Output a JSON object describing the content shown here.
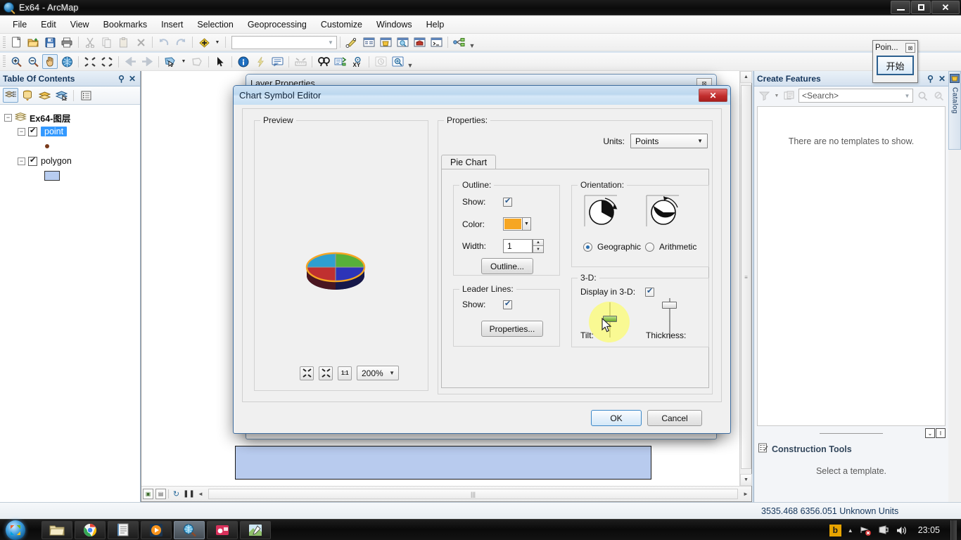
{
  "window": {
    "title": "Ex64 - ArcMap",
    "minimize_label": "—",
    "maximize_label": "❐",
    "close_label": "✕"
  },
  "menu": {
    "items": [
      {
        "label": "File"
      },
      {
        "label": "Edit"
      },
      {
        "label": "View"
      },
      {
        "label": "Bookmarks"
      },
      {
        "label": "Insert"
      },
      {
        "label": "Selection"
      },
      {
        "label": "Geoprocessing"
      },
      {
        "label": "Customize"
      },
      {
        "label": "Windows"
      },
      {
        "label": "Help"
      }
    ]
  },
  "toolbar_standard": {
    "icons": [
      "new-document-icon",
      "open-folder-icon",
      "save-icon",
      "print-icon",
      "cut-icon",
      "copy-icon",
      "paste-icon",
      "delete-icon",
      "undo-icon",
      "redo-icon",
      "add-data-icon"
    ],
    "scale_value": "",
    "scale_placeholder": "",
    "right_icons": [
      "editor-toolbar-icon",
      "table-of-contents-icon",
      "catalog-window-icon",
      "search-window-icon",
      "arctoolbox-icon",
      "python-window-icon",
      "modelbuilder-icon"
    ]
  },
  "toolbar_tools": {
    "icons": [
      "zoom-in-icon",
      "zoom-out-icon",
      "pan-icon",
      "full-extent-icon",
      "fixed-zoom-in-icon",
      "fixed-zoom-out-icon",
      "go-back-icon",
      "go-forward-icon",
      "select-features-icon",
      "clear-selection-icon",
      "select-elements-icon",
      "identify-icon",
      "hyperlink-icon",
      "html-popup-icon",
      "measure-icon",
      "find-icon",
      "find-route-icon",
      "go-to-xy-icon",
      "time-slider-icon",
      "create-viewer-icon"
    ]
  },
  "toc": {
    "title": "Table Of Contents",
    "pin_icon": "pin-icon",
    "close_icon": "close-icon",
    "toolbar_icons": [
      "list-by-drawing-order-icon",
      "list-by-source-icon",
      "list-by-visibility-icon",
      "list-by-selection-icon",
      "options-icon"
    ],
    "tree": {
      "root_label": "Ex64-图层",
      "layers": [
        {
          "label": "point",
          "checked": true,
          "selected": true,
          "symbol": "point-symbol"
        },
        {
          "label": "polygon",
          "checked": true,
          "selected": false,
          "symbol": "polygon-symbol"
        }
      ]
    }
  },
  "map": {
    "hbar_icons": [
      "data-view-icon",
      "layout-view-icon",
      "refresh-icon",
      "pause-icon"
    ],
    "scroll_left": "◄",
    "scroll_right": "►",
    "scroll_up": "▲",
    "scroll_down": "▼",
    "thumb_grip": "≡"
  },
  "point_floater": {
    "title": "Poin...",
    "close_label": "⊠",
    "start_button": "开始"
  },
  "layer_properties": {
    "title": "Layer Properties",
    "close_label": "⊠"
  },
  "create_features": {
    "title": "Create Features",
    "pin_icon": "pin-icon",
    "close_icon": "close-icon",
    "toolbar_icons": [
      "organize-templates-icon",
      "template-properties-icon"
    ],
    "search_value": "<Search>",
    "search_placeholder": "<Search>",
    "search_icons": [
      "search-icon",
      "clear-search-icon"
    ],
    "empty_message": "There are no templates to show.",
    "divider_buttons": [
      "⌄",
      "I"
    ],
    "construction_tools": {
      "icon": "construction-tools-icon",
      "title": "Construction Tools",
      "message": "Select a template."
    }
  },
  "catalog_tab": {
    "label": "Catalog",
    "icon": "catalog-icon"
  },
  "status_bar": {
    "coordinates": "3535.468  6356.051 Unknown Units"
  },
  "dialog": {
    "title": "Chart Symbol Editor",
    "close_label": "✕",
    "preview": {
      "group_label": "Preview",
      "zoom_buttons": [
        {
          "name": "zoom-out-preview-button",
          "glyph": "⤡⤢"
        },
        {
          "name": "zoom-in-preview-button",
          "glyph": "⤢⤡"
        },
        {
          "name": "actual-size-button",
          "glyph": "1:1"
        }
      ],
      "zoom_value": "200%",
      "zoom_dropdown_glyph": "▼",
      "symbol": {
        "type": "3d-pie-chart",
        "slices": [
          {
            "name": "slice-1",
            "color": "#2f9fd0"
          },
          {
            "name": "slice-2",
            "color": "#57b03a"
          },
          {
            "name": "slice-3",
            "color": "#c03030"
          },
          {
            "name": "slice-4",
            "color": "#2d34b8"
          }
        ],
        "outline_color": "#f6a623"
      }
    },
    "properties": {
      "group_label": "Properties:",
      "units_label": "Units:",
      "units_value": "Points",
      "dropdown_glyph": "▼",
      "tab_label": "Pie Chart",
      "outline": {
        "group_label": "Outline:",
        "show_label": "Show:",
        "show_checked": true,
        "color_label": "Color:",
        "color_value": "#f6a623",
        "width_label": "Width:",
        "width_value": "1",
        "spin_up": "▲",
        "spin_down": "▼",
        "button_label": "Outline..."
      },
      "leader_lines": {
        "group_label": "Leader Lines:",
        "show_label": "Show:",
        "show_checked": true,
        "button_label": "Properties..."
      },
      "orientation": {
        "group_label": "Orientation:",
        "options": [
          {
            "label": "Geographic",
            "selected": true
          },
          {
            "label": "Arithmetic",
            "selected": false
          }
        ]
      },
      "three_d": {
        "group_label": "3-D:",
        "display_label": "Display in 3-D:",
        "display_checked": true,
        "tilt_label": "Tilt:",
        "thickness_label": "Thickness:"
      }
    },
    "ok_label": "OK",
    "cancel_label": "Cancel"
  },
  "taskbar": {
    "start_icon": "windows-start-orb",
    "items": [
      {
        "name": "file-explorer-icon",
        "active": false
      },
      {
        "name": "chrome-icon",
        "active": false
      },
      {
        "name": "notepad-icon",
        "active": false
      },
      {
        "name": "media-player-icon",
        "active": false
      },
      {
        "name": "arcmap-icon",
        "active": true
      },
      {
        "name": "screen-recorder-icon",
        "active": false
      },
      {
        "name": "paint-icon",
        "active": false
      }
    ],
    "tray": {
      "ime_label": "b",
      "show_hidden": "▲",
      "icons": [
        "network-icon",
        "action-center-icon",
        "volume-icon"
      ],
      "clock": "23:05"
    }
  }
}
